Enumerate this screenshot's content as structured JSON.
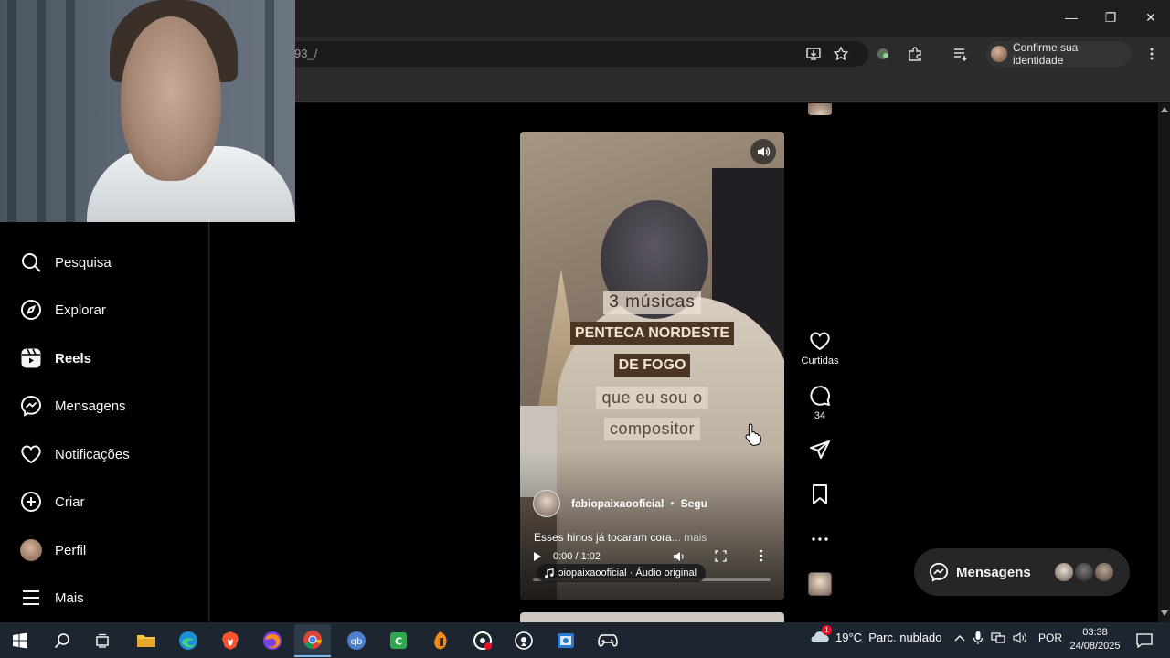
{
  "browser": {
    "url_fragment": "93_/",
    "profile_label": "Confirme sua identidade",
    "window_controls": [
      "minimize-icon",
      "restore-icon",
      "close-icon"
    ]
  },
  "sidebar": {
    "items": [
      {
        "key": "search",
        "label": "Pesquisa",
        "icon": "search-icon"
      },
      {
        "key": "explore",
        "label": "Explorar",
        "icon": "compass-icon"
      },
      {
        "key": "reels",
        "label": "Reels",
        "icon": "reels-icon",
        "active": true
      },
      {
        "key": "messages",
        "label": "Mensagens",
        "icon": "messenger-icon"
      },
      {
        "key": "notifications",
        "label": "Notificações",
        "icon": "heart-icon"
      },
      {
        "key": "create",
        "label": "Criar",
        "icon": "plus-square-icon"
      },
      {
        "key": "profile",
        "label": "Perfil",
        "icon": "avatar"
      },
      {
        "key": "more",
        "label": "Mais",
        "icon": "menu-icon"
      }
    ]
  },
  "reel": {
    "caption_lines": [
      "3 músicas",
      "PENTECA NORDESTE",
      "DE FOGO",
      "que eu sou o",
      "compositor"
    ],
    "author": "fabiopaixaooficial",
    "separator": "•",
    "follow_label": "Segu",
    "description": "Esses hinos já tocaram cora",
    "description_more": "... mais",
    "time": "0:00 / 1:02",
    "audio_label": "ɔiopaixaooficial · Áudio original",
    "progress": 0.0
  },
  "actions": {
    "like_label": "Curtidas",
    "comment_count": "34"
  },
  "messages_pill": {
    "label": "Mensagens"
  },
  "taskbar": {
    "weather": "19°C  Parc. nublado",
    "weather_badge": "1",
    "language": "POR",
    "time": "03:38",
    "date": "24/08/2025"
  },
  "colors": {
    "accent": "#7cb8f0",
    "bg": "#000000",
    "caption_bold_bg": "#4a3623"
  }
}
